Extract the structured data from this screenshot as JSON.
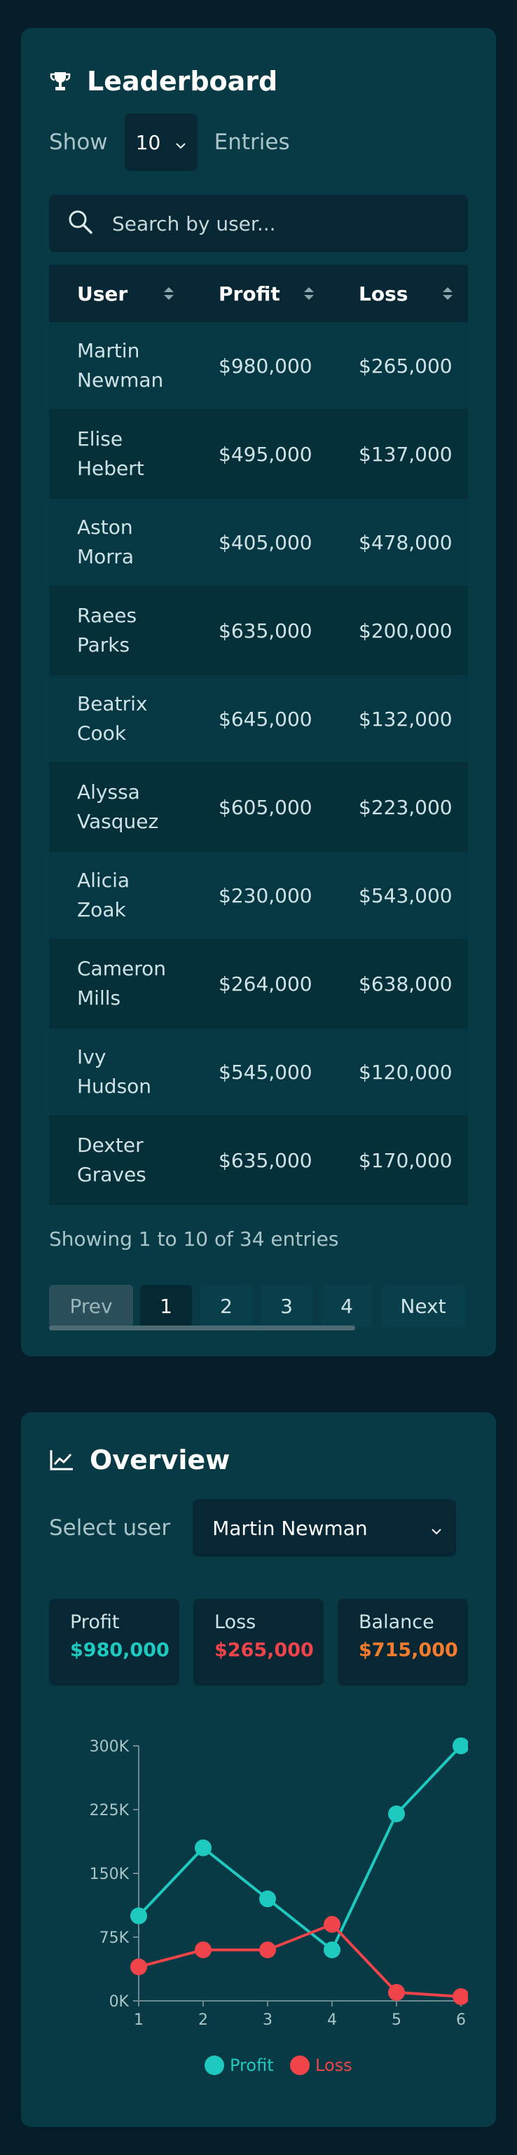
{
  "leaderboard": {
    "title": "Leaderboard",
    "show_label": "Show",
    "entries_value": "10",
    "entries_label": "Entries",
    "search_placeholder": "Search by user...",
    "columns": [
      "User",
      "Profit",
      "Loss"
    ],
    "rows": [
      {
        "user": "Martin Newman",
        "profit": "$980,000",
        "loss": "$265,000"
      },
      {
        "user": "Elise Hebert",
        "profit": "$495,000",
        "loss": "$137,000"
      },
      {
        "user": "Aston Morra",
        "profit": "$405,000",
        "loss": "$478,000"
      },
      {
        "user": "Raees Parks",
        "profit": "$635,000",
        "loss": "$200,000"
      },
      {
        "user": "Beatrix Cook",
        "profit": "$645,000",
        "loss": "$132,000"
      },
      {
        "user": "Alyssa Vasquez",
        "profit": "$605,000",
        "loss": "$223,000"
      },
      {
        "user": "Alicia Zoak",
        "profit": "$230,000",
        "loss": "$543,000"
      },
      {
        "user": "Cameron Mills",
        "profit": "$264,000",
        "loss": "$638,000"
      },
      {
        "user": "Ivy Hudson",
        "profit": "$545,000",
        "loss": "$120,000"
      },
      {
        "user": "Dexter Graves",
        "profit": "$635,000",
        "loss": "$170,000"
      }
    ],
    "showing_text": "Showing 1 to 10 of 34 entries",
    "pagination": {
      "prev": "Prev",
      "pages": [
        "1",
        "2",
        "3",
        "4"
      ],
      "next": "Next",
      "current_page": "1"
    }
  },
  "overview": {
    "title": "Overview",
    "select_label": "Select user",
    "selected_user": "Martin Newman",
    "stats": [
      {
        "label": "Profit",
        "value": "$980,000",
        "color": "#1ec9c0"
      },
      {
        "label": "Loss",
        "value": "$265,000",
        "color": "#f0434a"
      },
      {
        "label": "Balance",
        "value": "$715,000",
        "color": "#f57c2c"
      }
    ]
  },
  "chart_data": {
    "type": "line",
    "x": [
      1,
      2,
      3,
      4,
      5,
      6
    ],
    "xticks": [
      "1",
      "2",
      "3",
      "4",
      "5",
      "6"
    ],
    "yticks": [
      "0K",
      "75K",
      "150K",
      "225K",
      "300K"
    ],
    "ylim": [
      0,
      300000
    ],
    "grid": false,
    "legend_position": "bottom",
    "series": [
      {
        "name": "Profit",
        "color": "#1ec9c0",
        "values": [
          100000,
          180000,
          120000,
          60000,
          220000,
          300000
        ]
      },
      {
        "name": "Loss",
        "color": "#f0434a",
        "values": [
          40000,
          60000,
          60000,
          90000,
          10000,
          5000
        ]
      }
    ]
  },
  "colors": {
    "background": "#051d29",
    "card": "#073a44",
    "input": "#062733"
  }
}
